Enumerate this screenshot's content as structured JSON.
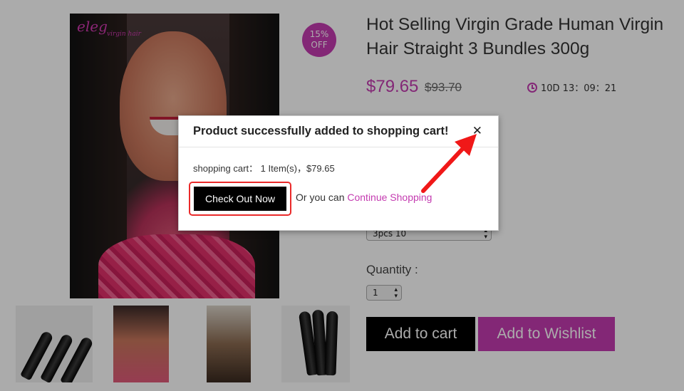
{
  "product": {
    "title": "Hot Selling Virgin Grade Human Virgin Hair Straight 3 Bundles 300g",
    "price_now": "$79.65",
    "price_old": "$93.70",
    "countdown": "10D 13：09：21",
    "discount": {
      "line1": "15%",
      "line2": "OFF"
    },
    "brand_logo": {
      "script": "eleg",
      "sub": "virgin hair"
    }
  },
  "options": {
    "length_selected": "3pcs 10",
    "quantity_label": "Quantity :",
    "quantity_selected": "1"
  },
  "buttons": {
    "add_to_cart": "Add to cart",
    "add_to_wishlist": "Add to Wishlist"
  },
  "modal": {
    "title": "Product successfully added to shopping cart!",
    "cart_summary": "shopping cart： 1 Item(s)，$79.65",
    "checkout_label": "Check Out Now",
    "or_text": "Or you can",
    "continue_label": "Continue Shopping",
    "close_symbol": "✕"
  },
  "colors": {
    "accent": "#c43bb0",
    "highlight_outline": "#ea2a2a",
    "annotation_arrow": "#f01818"
  },
  "icons": [
    "clock-icon",
    "close-icon",
    "select-arrow-icon"
  ]
}
